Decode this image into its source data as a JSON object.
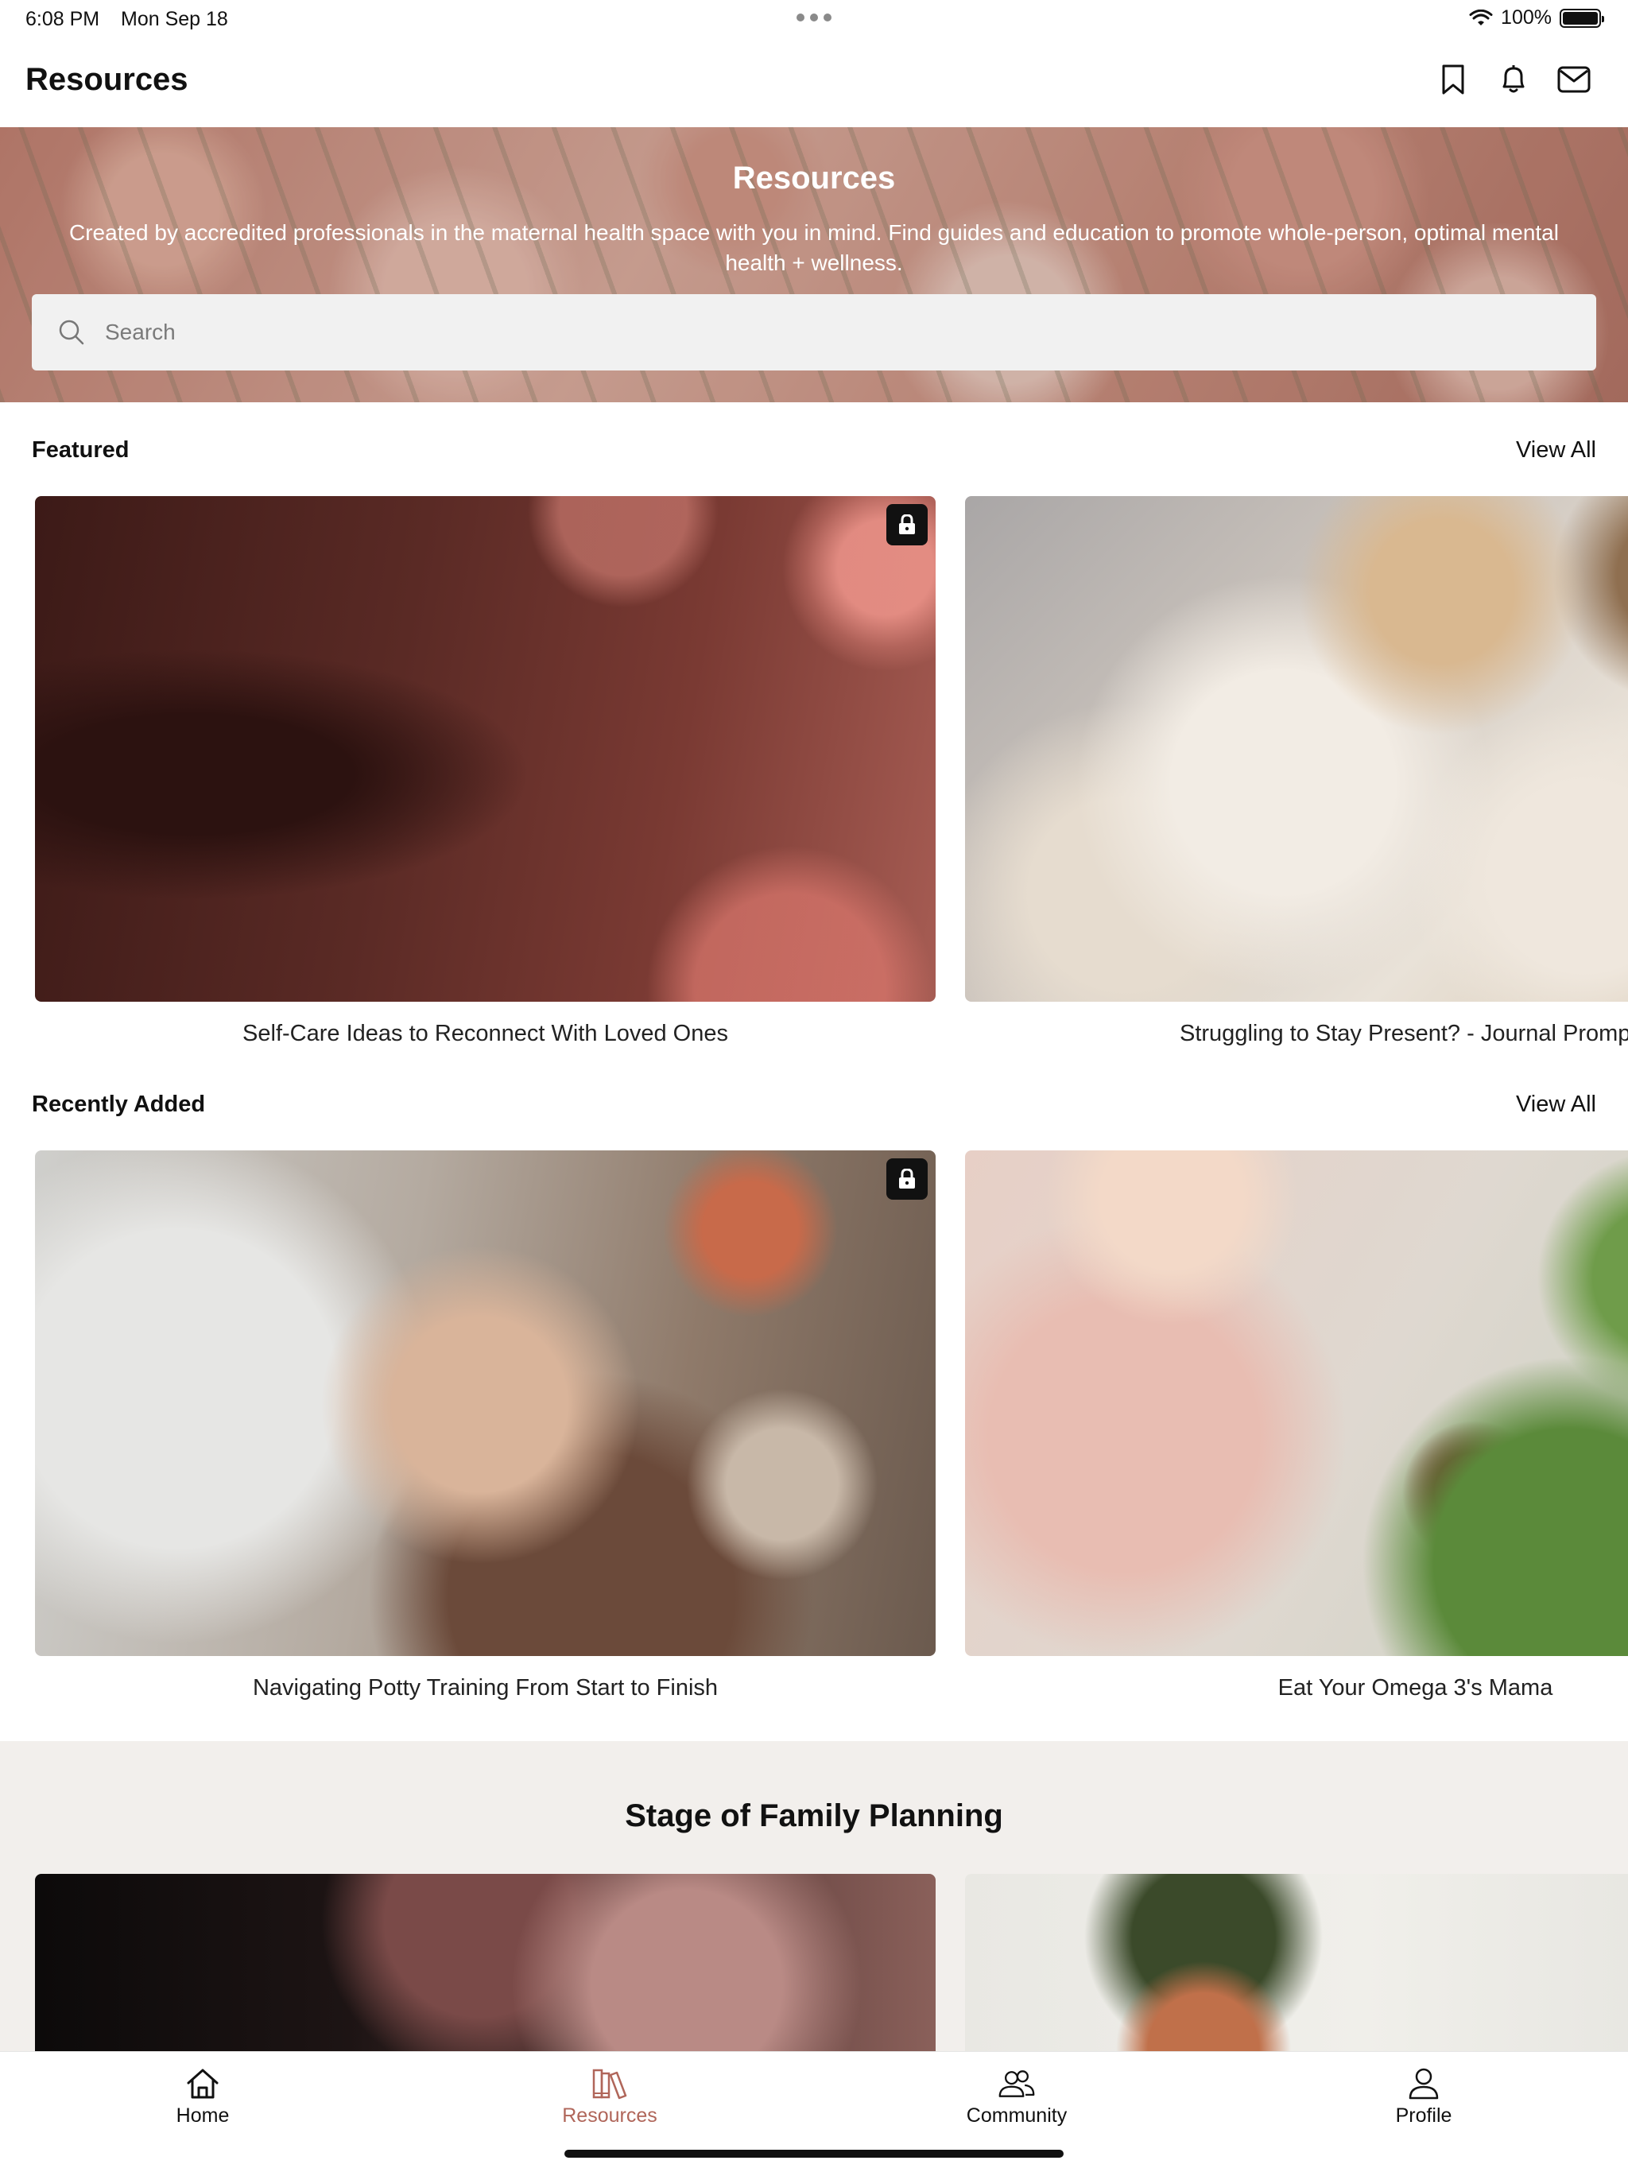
{
  "status_bar": {
    "time": "6:08 PM",
    "date": "Mon Sep 18",
    "battery": "100%"
  },
  "header": {
    "title": "Resources",
    "icons": [
      "bookmark-icon",
      "bell-icon",
      "mail-icon"
    ]
  },
  "hero": {
    "title": "Resources",
    "description": "Created by accredited professionals in the maternal health space with you in mind. Find guides and education to promote whole-person, optimal mental health + wellness.",
    "search_placeholder": "Search"
  },
  "featured": {
    "title": "Featured",
    "view_all": "View All",
    "items": [
      {
        "title": "Self-Care Ideas to Reconnect With Loved Ones",
        "locked": true
      },
      {
        "title": "Struggling to Stay Present? - Journal Promp",
        "locked": false
      }
    ]
  },
  "recent": {
    "title": "Recently Added",
    "view_all": "View All",
    "items": [
      {
        "title": "Navigating Potty Training From Start to Finish",
        "locked": true
      },
      {
        "title": "Eat Your Omega 3's Mama",
        "locked": false
      }
    ]
  },
  "stage": {
    "title": "Stage of Family Planning"
  },
  "tab_bar": {
    "items": [
      {
        "label": "Home",
        "icon": "home-icon",
        "active": false
      },
      {
        "label": "Resources",
        "icon": "books-icon",
        "active": true
      },
      {
        "label": "Community",
        "icon": "community-icon",
        "active": false
      },
      {
        "label": "Profile",
        "icon": "profile-icon",
        "active": false
      }
    ]
  },
  "colors": {
    "accent": "#b0665a",
    "stage_background": "#f2efec",
    "search_background": "#f1f1f1"
  }
}
